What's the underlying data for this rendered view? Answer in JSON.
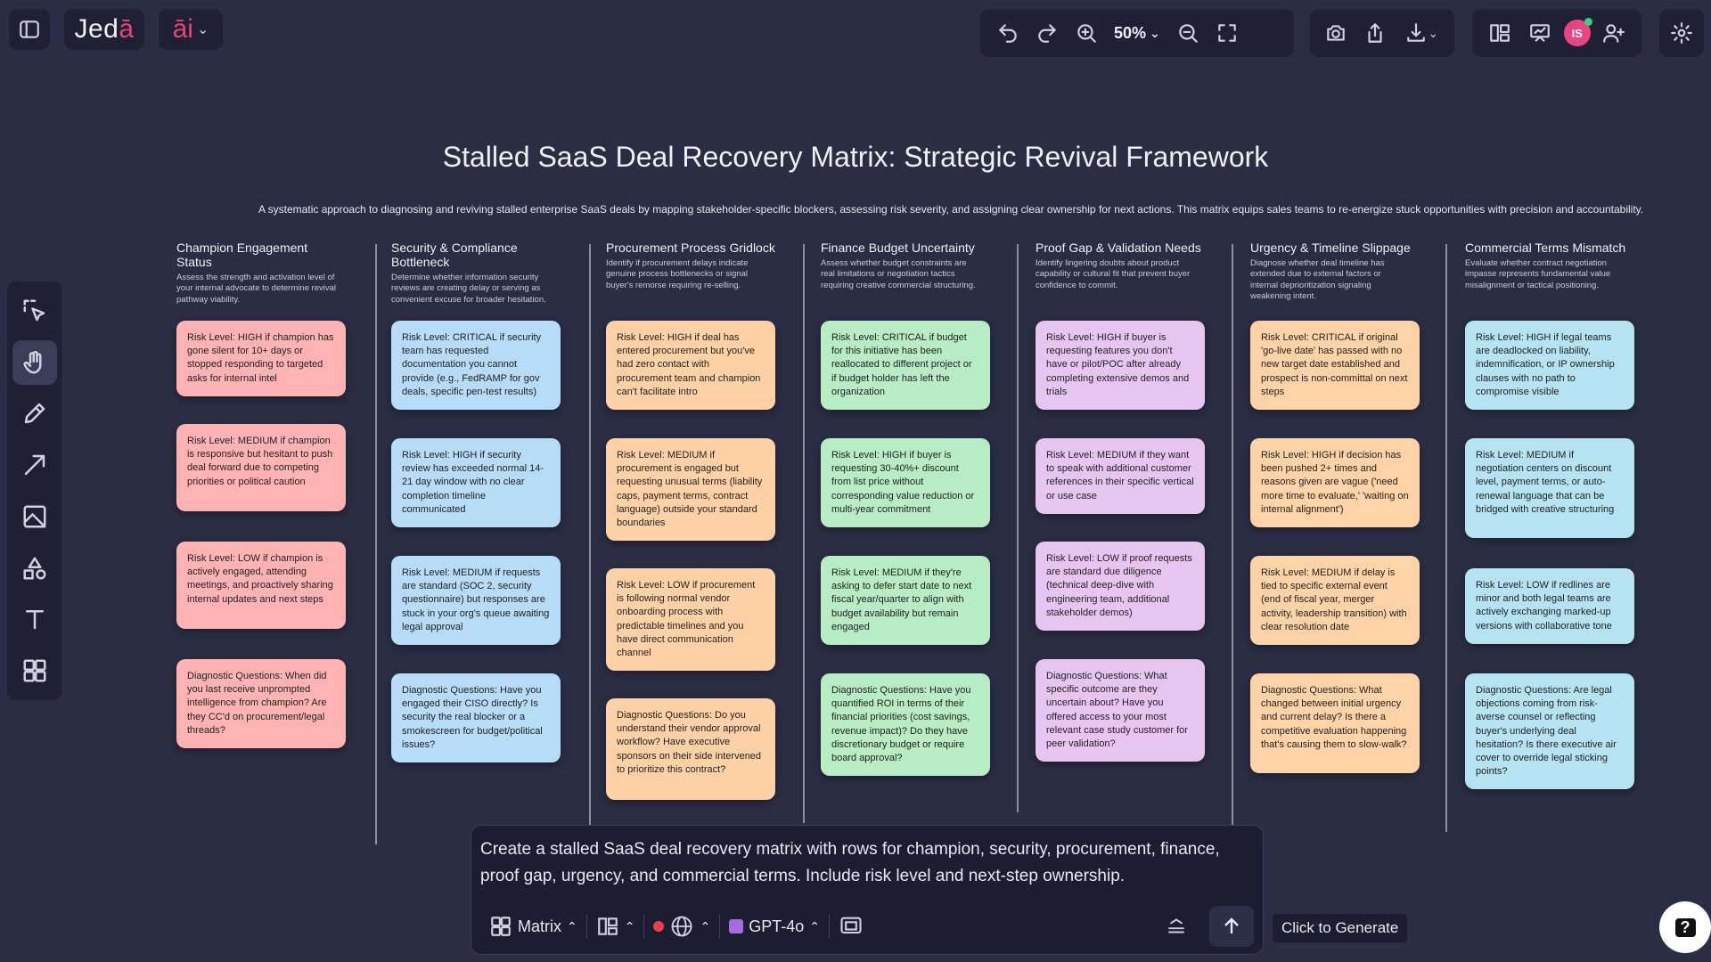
{
  "app": {
    "logo": "Jed",
    "logo_accent": "ā",
    "ai_label": "āi"
  },
  "toolbar": {
    "zoom": "50%"
  },
  "user": {
    "initials": "IS"
  },
  "canvas": {
    "title": "Stalled SaaS Deal Recovery Matrix: Strategic Revival Framework",
    "subtitle": "A systematic approach to diagnosing and reviving stalled enterprise SaaS deals by mapping stakeholder-specific blockers, assessing risk severity, and assigning clear ownership for next actions. This matrix equips sales teams to re-energize stuck opportunities with precision and accountability.",
    "columns": [
      {
        "title": "Champion Engagement Status",
        "desc": "Assess the strength and activation level of your internal advocate to determine revival pathway viability.",
        "color": "#ffb3b3",
        "cards": [
          "Risk Level: HIGH if champion has gone silent for 10+ days or stopped responding to targeted asks for internal intel",
          "Risk Level: MEDIUM if champion is responsive but hesitant to push deal forward due to competing priorities or political caution",
          "Risk Level: LOW if champion is actively engaged, attending meetings, and proactively sharing internal updates and next steps",
          "Diagnostic Questions: When did you last receive unprompted intelligence from champion? Are they CC'd on procurement/legal threads?"
        ]
      },
      {
        "title": "Security & Compliance Bottleneck",
        "desc": "Determine whether information security reviews are creating delay or serving as convenient excuse for broader hesitation.",
        "color": "#b7dcf7",
        "cards": [
          "Risk Level: CRITICAL if security team has requested documentation you cannot provide (e.g., FedRAMP for gov deals, specific pen-test results)",
          "Risk Level: HIGH if security review has exceeded normal 14-21 day window with no clear completion timeline communicated",
          "Risk Level: MEDIUM if requests are standard (SOC 2, security questionnaire) but responses are stuck in your org's queue awaiting legal approval",
          "Diagnostic Questions: Have you engaged their CISO directly? Is security the real blocker or a smokescreen for budget/political issues?"
        ]
      },
      {
        "title": "Procurement Process Gridlock",
        "desc": "Identify if procurement delays indicate genuine process bottlenecks or signal buyer's remorse requiring re-selling.",
        "color": "#ffd1a6",
        "cards": [
          "Risk Level: HIGH if deal has entered procurement but you've had zero contact with procurement team and champion can't facilitate intro",
          "Risk Level: MEDIUM if procurement is engaged but requesting unusual terms (liability caps, payment terms, contract language) outside your standard boundaries",
          "Risk Level: LOW if procurement is following normal vendor onboarding process with predictable timelines and you have direct communication channel",
          "Diagnostic Questions: Do you understand their vendor approval workflow? Have executive sponsors on their side intervened to prioritize this contract?"
        ]
      },
      {
        "title": "Finance Budget Uncertainty",
        "desc": "Assess whether budget constraints are real limitations or negotiation tactics requiring creative commercial structuring.",
        "color": "#b8ecc4",
        "cards": [
          "Risk Level: CRITICAL if budget for this initiative has been reallocated to different project or if budget holder has left the organization",
          "Risk Level: HIGH if buyer is requesting 30-40%+ discount from list price without corresponding value reduction or multi-year commitment",
          "Risk Level: MEDIUM if they're asking to defer start date to next fiscal year/quarter to align with budget availability but remain engaged",
          "Diagnostic Questions: Have you quantified ROI in terms of their financial priorities (cost savings, revenue impact)? Do they have discretionary budget or require board approval?"
        ]
      },
      {
        "title": "Proof Gap & Validation Needs",
        "desc": "Identify lingering doubts about product capability or cultural fit that prevent buyer confidence to commit.",
        "color": "#e6c6f0",
        "cards": [
          "Risk Level: HIGH if buyer is requesting features you don't have or pilot/POC after already completing extensive demos and trials",
          "Risk Level: MEDIUM if they want to speak with additional customer references in their specific vertical or use case",
          "Risk Level: LOW if proof requests are standard due diligence (technical deep-dive with engineering team, additional stakeholder demos)",
          "Diagnostic Questions: What specific outcome are they uncertain about? Have you offered access to your most relevant case study customer for peer validation?"
        ]
      },
      {
        "title": "Urgency & Timeline Slippage",
        "desc": "Diagnose whether deal timeline has extended due to external factors or internal deprioritization signaling weakening intent.",
        "color": "#ffd3a8",
        "cards": [
          "Risk Level: CRITICAL if original 'go-live date' has passed with no new target date established and prospect is non-committal on next steps",
          "Risk Level: HIGH if decision has been pushed 2+ times and reasons given are vague ('need more time to evaluate,' 'waiting on internal alignment')",
          "Risk Level: MEDIUM if delay is tied to specific external event (end of fiscal year, merger activity, leadership transition) with clear resolution date",
          "Diagnostic Questions: What changed between initial urgency and current delay? Is there a competitive evaluation happening that's causing them to slow-walk?"
        ]
      },
      {
        "title": "Commercial Terms Mismatch",
        "desc": "Evaluate whether contract negotiation impasse represents fundamental value misalignment or tactical positioning.",
        "color": "#b5e3f2",
        "cards": [
          "Risk Level: HIGH if legal teams are deadlocked on liability, indemnification, or IP ownership clauses with no path to compromise visible",
          "Risk Level: MEDIUM if negotiation centers on discount level, payment terms, or auto-renewal language that can be bridged with creative structuring",
          "Risk Level: LOW if redlines are minor and both legal teams are actively exchanging marked-up versions with collaborative tone",
          "Diagnostic Questions: Are legal objections coming from risk-averse counsel or reflecting buyer's underlying deal hesitation? Is there executive air cover to override legal sticking points?"
        ]
      }
    ]
  },
  "prompt": {
    "text": "Create a stalled SaaS deal recovery matrix with rows for champion, security, procurement, finance, proof gap, urgency, and commercial terms. Include risk level and next-step ownership.",
    "template_label": "Matrix",
    "model_label": "GPT-4o",
    "tooltip": "Click to Generate"
  }
}
